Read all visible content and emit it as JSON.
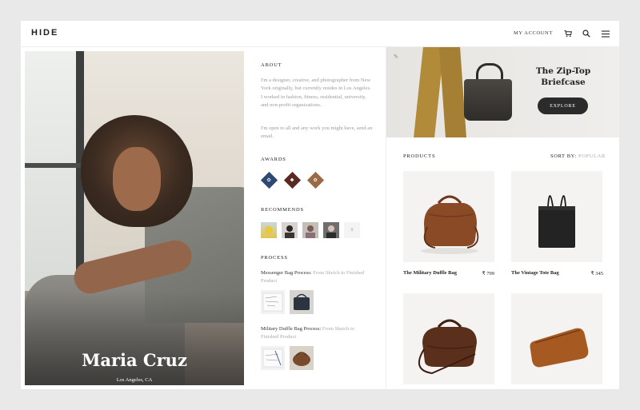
{
  "header": {
    "logo": "HIDE",
    "account_label": "MY ACCOUNT",
    "icons": [
      "cart-icon",
      "search-icon",
      "menu-icon"
    ]
  },
  "profile": {
    "name": "Maria Cruz",
    "location": "Los Angeles, CA"
  },
  "about": {
    "title": "ABOUT",
    "paragraph1": "I'm a designer, creative, and photographer from New York originally, but currently resides in Los Angeles. I worked in fashion, fitness, residential, university, and non-profit organizations.",
    "paragraph2": "I'm open to all and any work you might have, send an email."
  },
  "awards": {
    "title": "AWARDS",
    "items": [
      {
        "icon": "award-badge-icon",
        "color": "#2e4a73"
      },
      {
        "icon": "award-badge-icon",
        "color": "#5a2a22"
      },
      {
        "icon": "award-badge-icon",
        "color": "#9b6a45"
      }
    ]
  },
  "recommends": {
    "title": "RECOMMENDS",
    "more": "8"
  },
  "process": {
    "title": "PROCESS",
    "items": [
      {
        "label": "Messenger Bag Process:",
        "link": "From Sketch to Finished Product"
      },
      {
        "label": "Military Duffle Bag Process:",
        "link": "From Sketch to Finished Product"
      }
    ]
  },
  "hero": {
    "title": "The Zip-Top Briefcase",
    "button": "EXPLORE"
  },
  "products": {
    "title": "PRODUCTS",
    "sort_label": "SORT BY:",
    "sort_value": "POPULAR",
    "items": [
      {
        "name": "The Military Duffle Bag",
        "price": "₹ 799"
      },
      {
        "name": "The Vintage Tote Bag",
        "price": "₹ 345"
      },
      {
        "name": "",
        "price": ""
      },
      {
        "name": "",
        "price": ""
      }
    ]
  },
  "colors": {
    "accent": "#2b2b2b",
    "background": "#e9e9e9",
    "muted_text": "#9b9b9b"
  }
}
